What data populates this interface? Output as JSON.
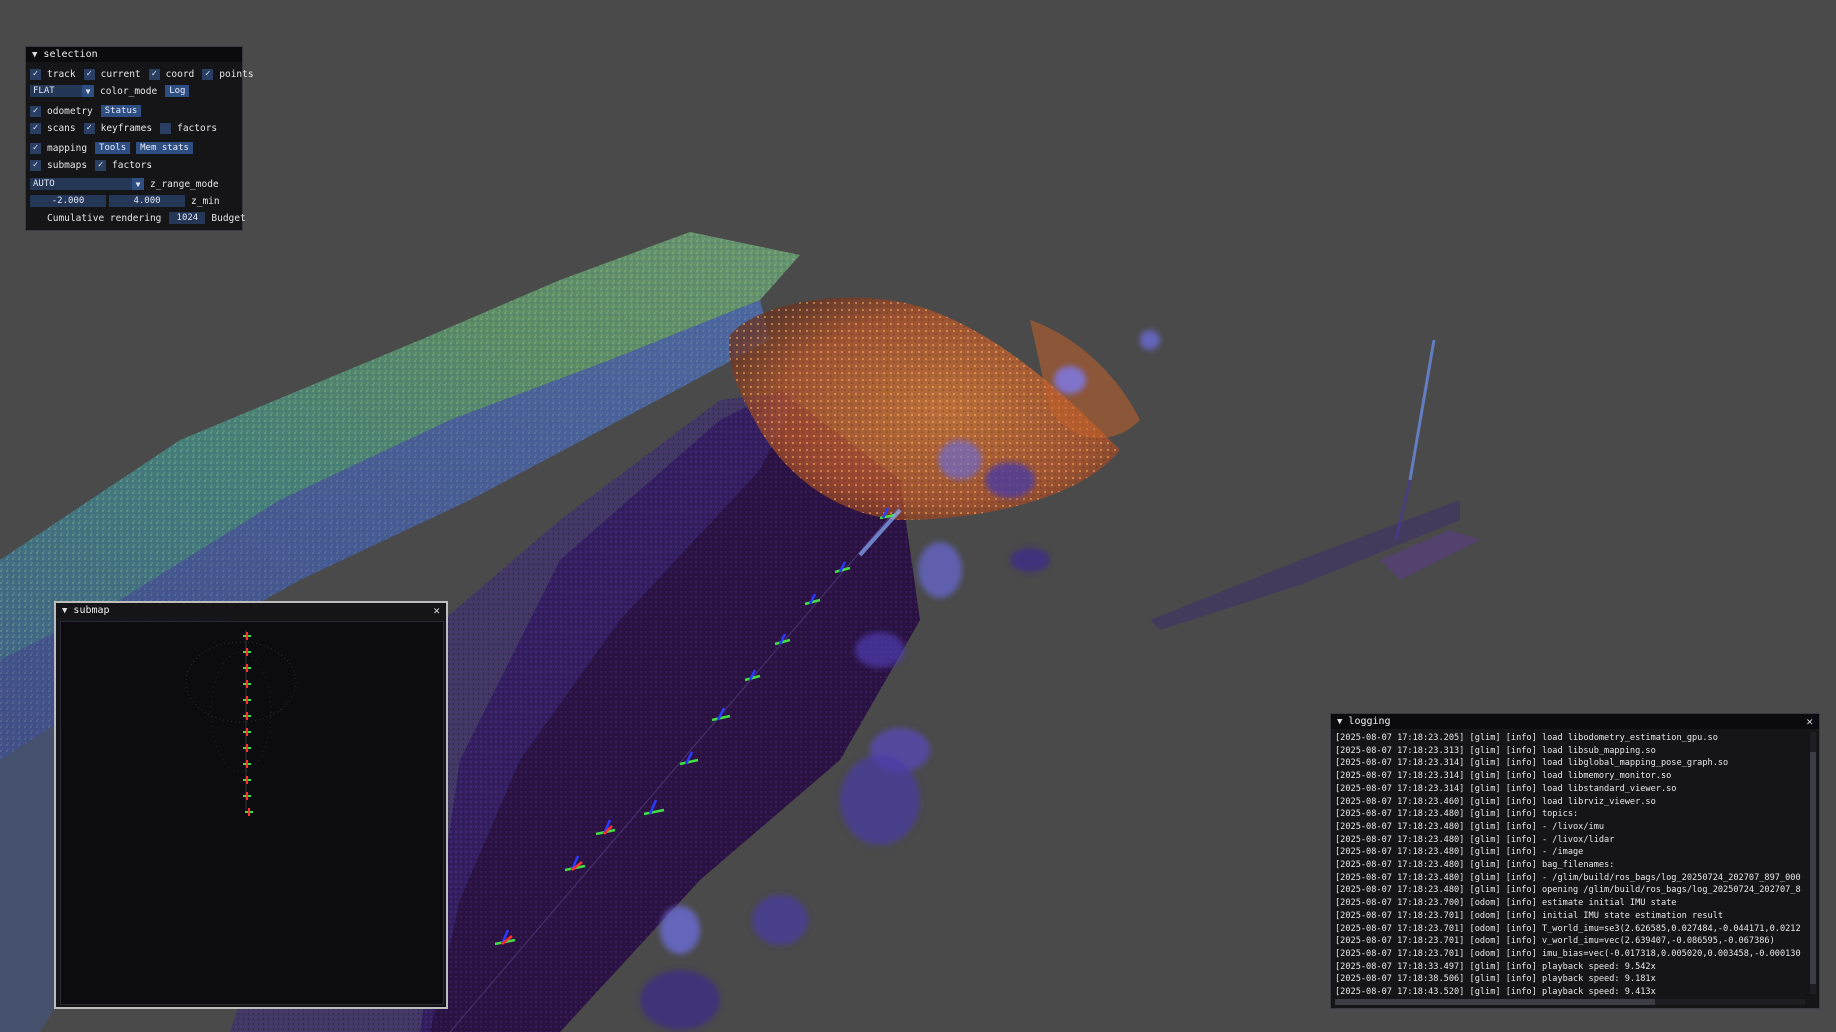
{
  "selection": {
    "title": "selection",
    "row1": {
      "track": "track",
      "current": "current",
      "coord": "coord",
      "points": "points"
    },
    "row2": {
      "color_mode_value": "FLAT",
      "color_mode_label": "color_mode",
      "log_button": "Log"
    },
    "row3": {
      "odometry": "odometry",
      "status_button": "Status"
    },
    "row4": {
      "scans": "scans",
      "keyframes": "keyframes",
      "factors": "factors"
    },
    "row5": {
      "mapping": "mapping",
      "tools_button": "Tools",
      "mem_stats_button": "Mem stats"
    },
    "row6": {
      "submaps": "submaps",
      "factors": "factors"
    },
    "row7": {
      "z_range_mode_value": "AUTO",
      "z_range_mode_label": "z_range_mode"
    },
    "row8": {
      "z_min_value": "-2.000",
      "z_max_value": "4.000",
      "z_min_label": "z_min"
    },
    "row9": {
      "cumulative_label": "Cumulative rendering",
      "budget_value": "1024",
      "budget_label": "Budget"
    }
  },
  "submap": {
    "title": "submap"
  },
  "logging": {
    "title": "logging",
    "lines": [
      "[2025-08-07 17:18:23.205] [glim] [info] load libodometry_estimation_gpu.so",
      "[2025-08-07 17:18:23.313] [glim] [info] load libsub_mapping.so",
      "[2025-08-07 17:18:23.314] [glim] [info] load libglobal_mapping_pose_graph.so",
      "[2025-08-07 17:18:23.314] [glim] [info] load libmemory_monitor.so",
      "[2025-08-07 17:18:23.314] [glim] [info] load libstandard_viewer.so",
      "[2025-08-07 17:18:23.460] [glim] [info] load librviz_viewer.so",
      "[2025-08-07 17:18:23.480] [glim] [info] topics:",
      "[2025-08-07 17:18:23.480] [glim] [info] - /livox/imu",
      "[2025-08-07 17:18:23.480] [glim] [info] - /livox/lidar",
      "[2025-08-07 17:18:23.480] [glim] [info] - /image",
      "[2025-08-07 17:18:23.480] [glim] [info] bag_filenames:",
      "[2025-08-07 17:18:23.480] [glim] [info] - /glim/build/ros_bags/log_20250724_202707_897_000",
      "[2025-08-07 17:18:23.480] [glim] [info] opening /glim/build/ros_bags/log_20250724_202707_8",
      "[2025-08-07 17:18:23.700] [odom] [info] estimate initial IMU state",
      "[2025-08-07 17:18:23.701] [odom] [info] initial IMU state estimation result",
      "[2025-08-07 17:18:23.701] [odom] [info] T_world_imu=se3(2.626585,0.027484,-0.044171,0.0212",
      "[2025-08-07 17:18:23.701] [odom] [info] v_world_imu=vec(2.639407,-0.086595,-0.067386)",
      "[2025-08-07 17:18:23.701] [odom] [info] imu_bias=vec(-0.017318,0.005020,0.003458,-0.000130",
      "[2025-08-07 17:18:33.497] [glim] [info] playback speed: 9.542x",
      "[2025-08-07 17:18:38.506] [glim] [info] playback speed: 9.181x",
      "[2025-08-07 17:18:43.520] [glim] [info] playback speed: 9.413x"
    ]
  }
}
